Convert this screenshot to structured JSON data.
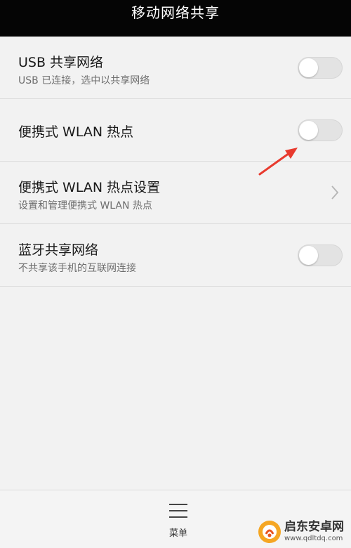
{
  "header": {
    "title": "移动网络共享"
  },
  "settings": {
    "items": [
      {
        "primary": "USB 共享网络",
        "secondary": "USB 已连接，选中以共享网络",
        "control": "toggle",
        "on": false
      },
      {
        "primary": "便携式 WLAN 热点",
        "secondary": "",
        "control": "toggle",
        "on": false
      },
      {
        "primary": "便携式 WLAN 热点设置",
        "secondary": "设置和管理便携式 WLAN 热点",
        "control": "chevron"
      },
      {
        "primary": "蓝牙共享网络",
        "secondary": "不共享该手机的互联网连接",
        "control": "toggle",
        "on": false
      }
    ]
  },
  "bottom_bar": {
    "menu_label": "菜单",
    "menu_icon": "hamburger-icon"
  },
  "watermark": {
    "text": "启东安卓网",
    "url": "www.qdltdq.com"
  },
  "colors": {
    "title_bar": "#050505",
    "background": "#f2f2f2",
    "toggle_off": "#e3e3e3",
    "annotation_arrow": "#e83a2e"
  }
}
